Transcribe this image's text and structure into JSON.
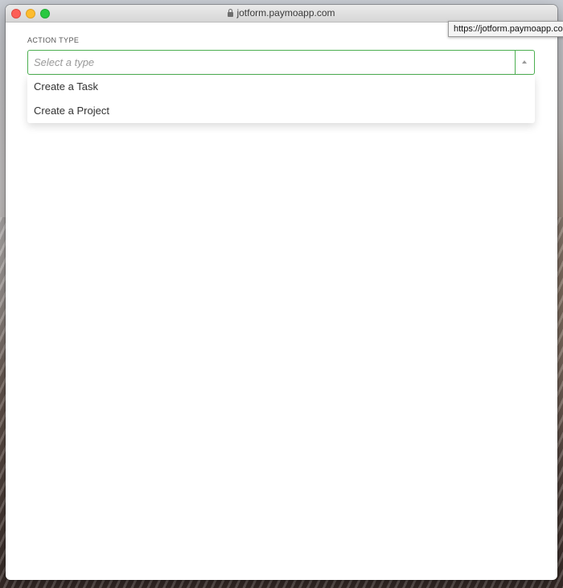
{
  "window": {
    "title": "jotform.paymoapp.com",
    "url_tooltip": "https://jotform.paymoapp.com"
  },
  "form": {
    "action_type_label": "ACTION TYPE",
    "select_placeholder": "Select a type",
    "options": [
      {
        "label": "Create a Task"
      },
      {
        "label": "Create a Project"
      }
    ]
  },
  "colors": {
    "accent_border": "#4caf50"
  },
  "icons": {
    "lock": "lock-icon",
    "dropdown_arrow": "caret-up-icon"
  }
}
